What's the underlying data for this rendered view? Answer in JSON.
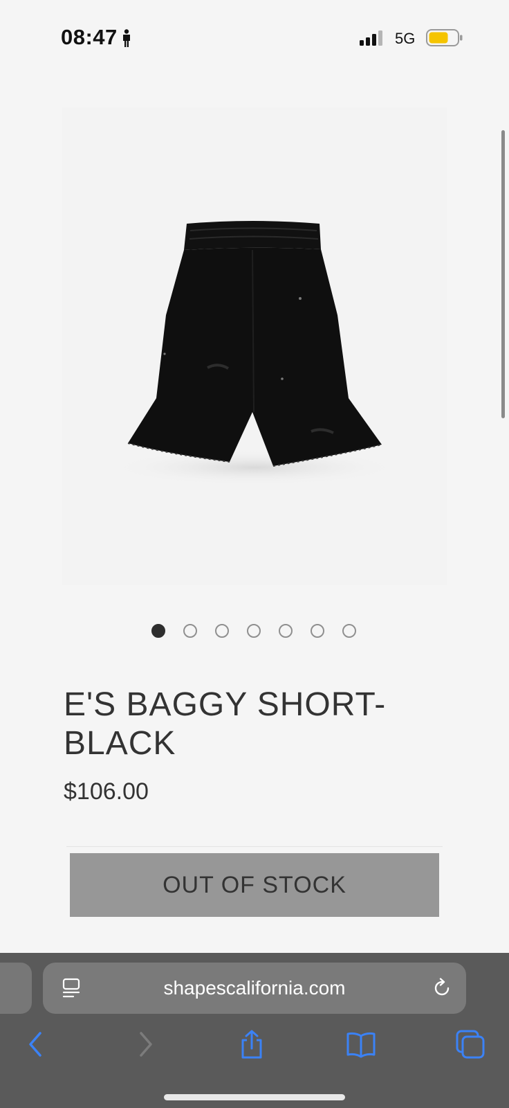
{
  "status_bar": {
    "time": "08:47",
    "network": "5G",
    "icons": [
      "person-icon",
      "signal-icon",
      "battery-icon"
    ],
    "battery_color": "#f5c400"
  },
  "product": {
    "image_description_icon": "baggy-shorts-image",
    "image_count": 7,
    "active_image_index": 0,
    "title": "E'S BAGGY SHORT-BLACK",
    "price": "$106.00",
    "stock_button_label": "OUT OF STOCK"
  },
  "browser": {
    "url": "shapescalifornia.com",
    "icons": [
      "reader-icon",
      "reload-icon",
      "back-icon",
      "forward-icon",
      "share-icon",
      "bookmarks-icon",
      "tabs-icon"
    ],
    "accent_color": "#3b82f6"
  }
}
